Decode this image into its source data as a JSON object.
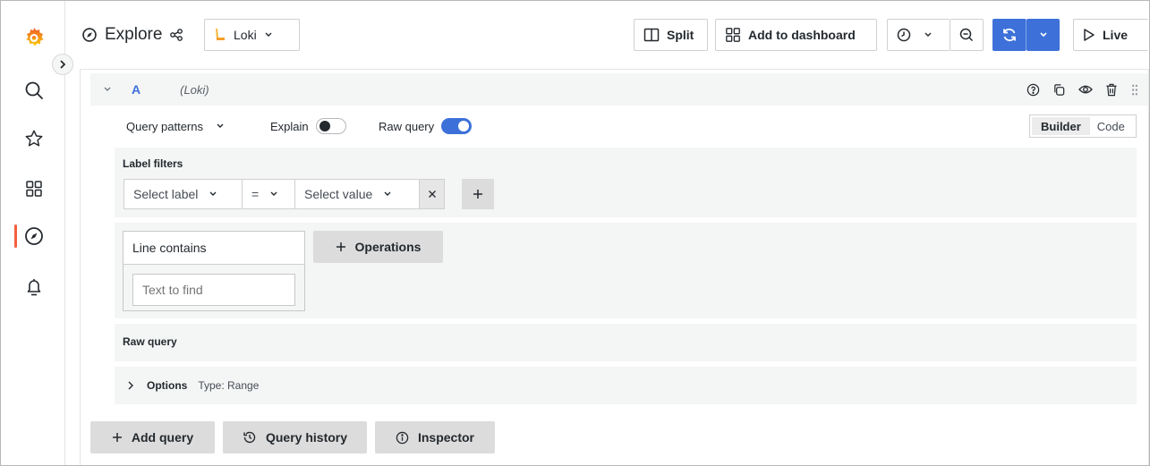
{
  "topbar": {
    "title": "Explore",
    "datasource": "Loki",
    "split_label": "Split",
    "add_dashboard_label": "Add to dashboard",
    "live_label": "Live"
  },
  "query": {
    "ref_id": "A",
    "datasource_hint": "(Loki)",
    "patterns_label": "Query patterns",
    "explain_label": "Explain",
    "raw_query_toggle_label": "Raw query",
    "mode_builder": "Builder",
    "mode_code": "Code",
    "explain_on": false,
    "raw_query_on": true
  },
  "label_filters": {
    "heading": "Label filters",
    "label_placeholder": "Select label",
    "operator": "=",
    "value_placeholder": "Select value"
  },
  "operations": {
    "line_contains_label": "Line contains",
    "text_placeholder": "Text to find",
    "add_operations_label": "Operations"
  },
  "raw_query": {
    "heading": "Raw query"
  },
  "options": {
    "label": "Options",
    "type_text": "Type: Range"
  },
  "footer": {
    "add_query_label": "Add query",
    "history_label": "Query history",
    "inspector_label": "Inspector"
  },
  "colors": {
    "accent": "#3d71d9",
    "brand": "#f55f3e",
    "panel_bg": "#f4f5f5"
  }
}
